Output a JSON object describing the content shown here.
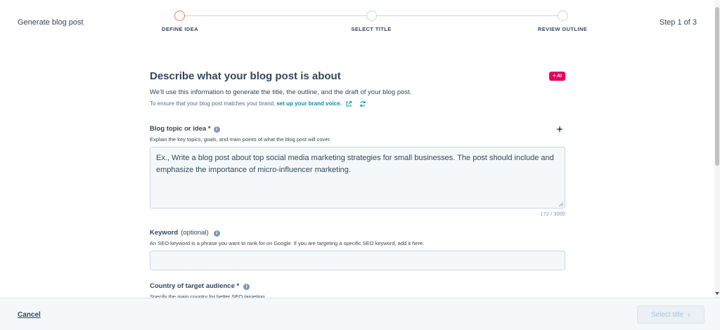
{
  "header": {
    "title": "Generate blog post",
    "step_counter": "Step 1 of 3",
    "steps": [
      {
        "label": "DEFINE IDEA",
        "active": true
      },
      {
        "label": "SELECT TITLE",
        "active": false
      },
      {
        "label": "REVIEW OUTLINE",
        "active": false
      }
    ]
  },
  "main": {
    "title": "Describe what your blog post is about",
    "ai_badge": "+ AI",
    "intro": "We'll use this information to generate the title, the outline, and the draft of your blog post.",
    "brand_prefix": "To ensure that your blog post matches your brand,",
    "brand_link": "set up your brand voice."
  },
  "topic": {
    "label": "Blog topic or idea *",
    "help": "Explain the key topics, goals, and main points of what the blog post will cover.",
    "placeholder": "Ex., Write a blog post about top social media marketing strategies for small businesses. The post should include and emphasize the importance of micro-influencer marketing.",
    "char_count": "172 / 3000"
  },
  "keyword": {
    "label": "Keyword",
    "optional": "(optional)",
    "help": "An SEO keyword is a phrase you want to rank for on Google. If you are targeting a specific SEO keyword, add it here.",
    "value": ""
  },
  "country": {
    "label": "Country of target audience *",
    "help": "Specify the main country for better SEO targeting."
  },
  "footer": {
    "cancel": "Cancel",
    "next": "Select title"
  },
  "colors": {
    "accent_active_step": "#ff7a59",
    "ai_badge": "#e5005c",
    "link": "#0091ae",
    "text": "#33475b"
  },
  "icons": {
    "external_link": "external-link-icon",
    "refresh": "refresh-icon",
    "info": "info-icon",
    "sparkle": "sparkle-icon",
    "chevron_right": "chevron-right-icon"
  }
}
